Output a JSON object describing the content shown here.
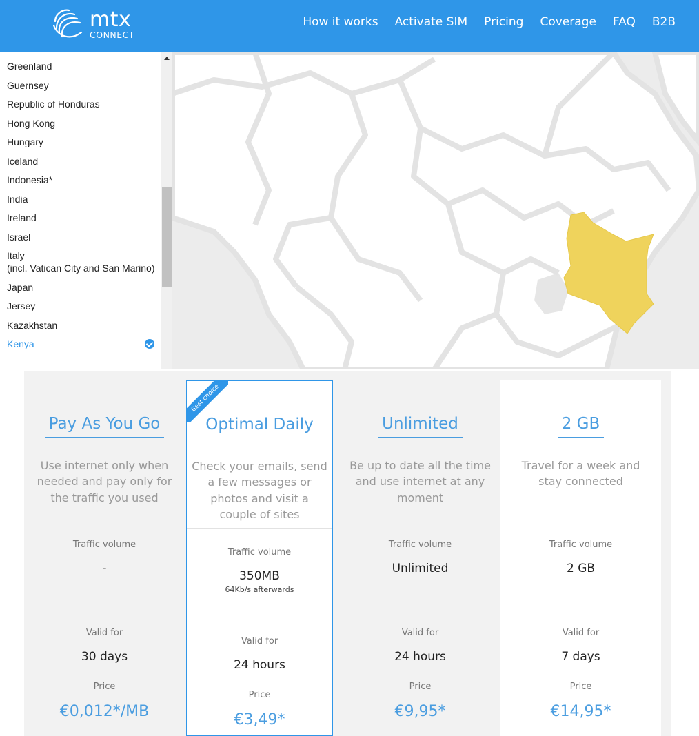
{
  "header": {
    "logo_text": "mtx",
    "logo_subtext": "CONNECT",
    "nav": [
      "How it works",
      "Activate SIM",
      "Pricing",
      "Coverage",
      "FAQ",
      "B2B"
    ]
  },
  "countries": {
    "items": [
      {
        "name": "Greenland"
      },
      {
        "name": "Guernsey"
      },
      {
        "name": "Republic of Honduras"
      },
      {
        "name": "Hong Kong"
      },
      {
        "name": "Hungary"
      },
      {
        "name": "Iceland"
      },
      {
        "name": "Indonesia*"
      },
      {
        "name": "India"
      },
      {
        "name": "Ireland"
      },
      {
        "name": "Israel"
      },
      {
        "name": "Italy",
        "note": "(incl. Vatican City and San Marino)"
      },
      {
        "name": "Japan"
      },
      {
        "name": "Jersey"
      },
      {
        "name": "Kazakhstan"
      },
      {
        "name": "Kenya",
        "selected": true
      }
    ]
  },
  "map": {
    "highlight_color": "#efd35c",
    "land_color": "#ffffff",
    "water_color": "#ececec",
    "selected_country": "Kenya"
  },
  "plans": [
    {
      "title": "Pay As You Go",
      "description": "Use internet only when needed and pay only for the traffic you used",
      "traffic_label": "Traffic volume",
      "traffic_value": "-",
      "traffic_note": "",
      "valid_label": "Valid for",
      "valid_value": "30 days",
      "price_label": "Price",
      "price_currency": "€",
      "price_value": "0,012*/MB"
    },
    {
      "title": "Optimal Daily",
      "badge": "Best choice",
      "description": "Check your emails, send a few messages or photos and visit a couple of sites",
      "traffic_label": "Traffic volume",
      "traffic_value": "350MB",
      "traffic_note": "64Kb/s afterwards",
      "valid_label": "Valid for",
      "valid_value": "24 hours",
      "price_label": "Price",
      "price_currency": "€",
      "price_value": "3,49*"
    },
    {
      "title": "Unlimited",
      "description": "Be up to date all the time and use internet at any moment",
      "traffic_label": "Traffic volume",
      "traffic_value": "Unlimited",
      "traffic_note": "",
      "valid_label": "Valid for",
      "valid_value": "24 hours",
      "price_label": "Price",
      "price_currency": "€",
      "price_value": "9,95*"
    },
    {
      "title": "2 GB",
      "description": "Travel for a week and stay connected",
      "traffic_label": "Traffic volume",
      "traffic_value": "2 GB",
      "traffic_note": "",
      "valid_label": "Valid for",
      "valid_value": "7 days",
      "price_label": "Price",
      "price_currency": "€",
      "price_value": "14,95*"
    }
  ]
}
